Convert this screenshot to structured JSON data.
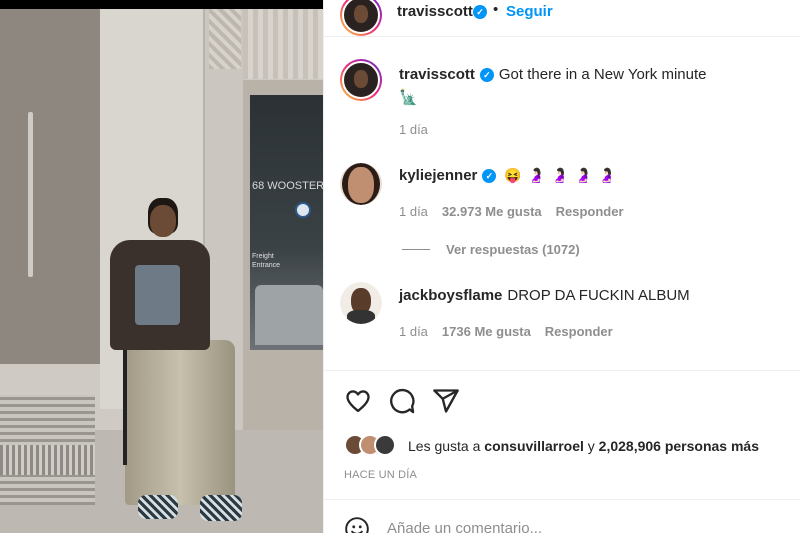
{
  "header": {
    "username": "travisscott",
    "separator": "•",
    "follow_label": "Seguir"
  },
  "caption": {
    "username": "travisscott",
    "text": "Got there in a New York minute",
    "emoji": "🗽",
    "time": "1 día"
  },
  "comments": [
    {
      "username": "kyliejenner",
      "verified": true,
      "emojis": [
        "😝",
        "🤰🏻",
        "🤰🏻",
        "🤰🏻",
        "🤰🏻"
      ],
      "time": "1 día",
      "likes": "32.973 Me gusta",
      "reply_label": "Responder",
      "view_replies": "Ver respuestas (1072)"
    },
    {
      "username": "jackboysflame",
      "verified": false,
      "text": "DROP DA FUCKIN ALBUM",
      "time": "1 día",
      "likes": "1736 Me gusta",
      "reply_label": "Responder"
    }
  ],
  "actions": {
    "icons": [
      "heart-icon",
      "comment-icon",
      "share-icon"
    ]
  },
  "likes_summary": {
    "prefix": "Les gusta a",
    "user": "consuvillarroel",
    "connector": "y",
    "others": "2,028,906 personas más"
  },
  "post_time": "HACE UN DÍA",
  "add_comment": {
    "placeholder": "Añade un comentario..."
  },
  "colors": {
    "accent": "#0095f6",
    "text": "#262626",
    "muted": "#8e8e8e",
    "divider": "#efefef"
  }
}
